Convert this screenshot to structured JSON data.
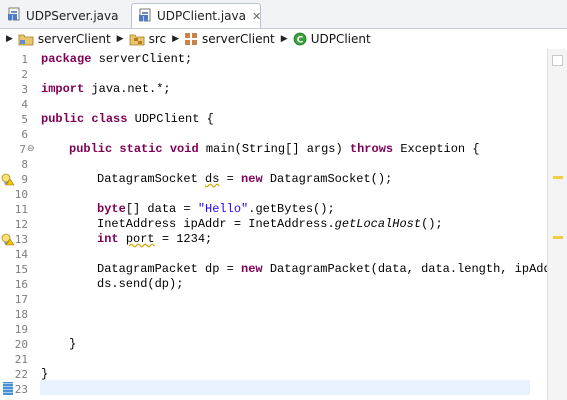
{
  "tabs": [
    {
      "label": "UDPServer.java",
      "active": false,
      "icon": "java-file-icon"
    },
    {
      "label": "UDPClient.java",
      "active": true,
      "icon": "java-file-icon",
      "close": "✕"
    }
  ],
  "breadcrumb": {
    "items": [
      {
        "label": "serverClient",
        "icon": "project-folder-icon"
      },
      {
        "label": "src",
        "icon": "source-folder-icon"
      },
      {
        "label": "serverClient",
        "icon": "package-icon"
      },
      {
        "label": "UDPClient",
        "icon": "class-icon"
      }
    ]
  },
  "editor": {
    "line_numbers": [
      "1",
      "2",
      "3",
      "4",
      "5",
      "6",
      "7",
      "8",
      "9",
      "10",
      "11",
      "12",
      "13",
      "14",
      "15",
      "16",
      "17",
      "18",
      "19",
      "20",
      "21",
      "22",
      "23"
    ],
    "fold_marker": "⊖",
    "code": {
      "l1_kw": "package",
      "l1_rest": " serverClient;",
      "l3_kw": "import",
      "l3_rest": " java.net.*;",
      "l5_kw1": "public",
      "l5_kw2": "class",
      "l5_rest": " UDPClient {",
      "l7_kw1": "public",
      "l7_kw2": "static",
      "l7_kw3": "void",
      "l7_a": " main(String[] ",
      "l7_args": "args",
      "l7_b": ") ",
      "l7_kw4": "throws",
      "l7_c": " Exception {",
      "l9_a": "DatagramSocket ",
      "l9_ds": "ds",
      "l9_b": " = ",
      "l9_kw": "new",
      "l9_c": " DatagramSocket();",
      "l11_kw": "byte",
      "l11_a": "[] data = ",
      "l11_str": "\"Hello\"",
      "l11_b": ".getBytes();",
      "l12_a": "InetAddress ",
      "l12_ip": "ipAddr",
      "l12_b": " = InetAddress.",
      "l12_it": "getLocalHost",
      "l12_c": "();",
      "l13_kw": "int",
      "l13_a": " ",
      "l13_port": "port",
      "l13_b": " = 1234;",
      "l15_a": "DatagramPacket dp = ",
      "l15_kw": "new",
      "l15_b": " DatagramPacket(data, data.length, ipAdd",
      "l16_a": "ds.send(dp);",
      "l20_a": "}",
      "l22_a": "}"
    }
  },
  "colors": {
    "keyword": "#7f0055",
    "string": "#2a00ff",
    "warning": "#f4cb47",
    "current_line": "#e8f2fe"
  }
}
